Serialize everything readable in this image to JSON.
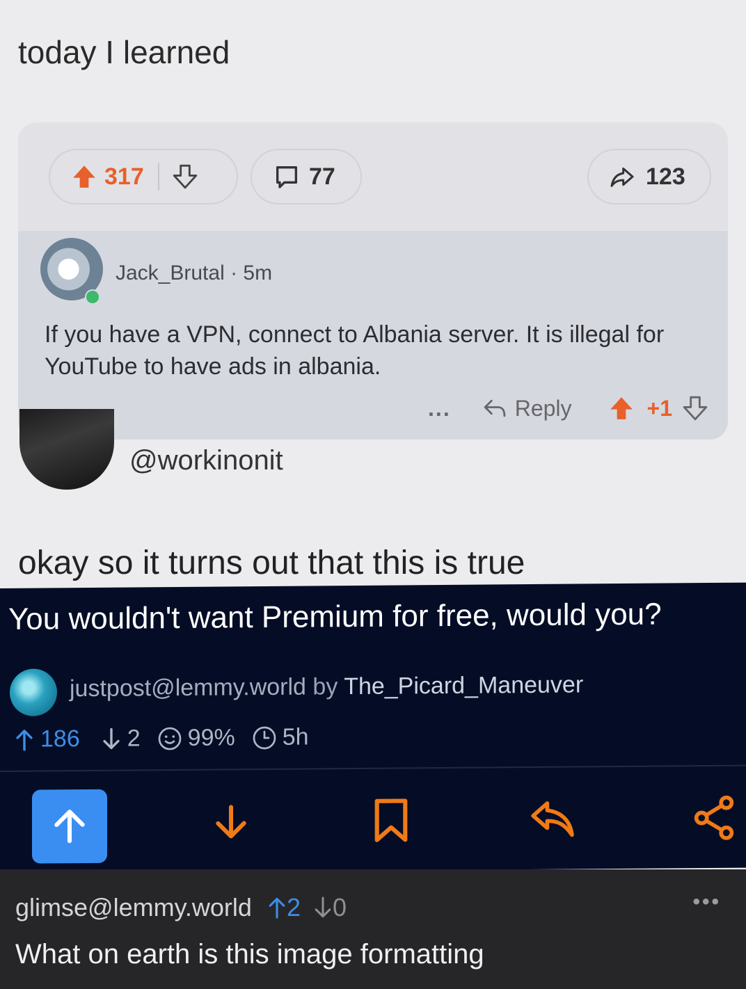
{
  "top": {
    "caption": "today I learned",
    "card": {
      "upvotes": "317",
      "comments": "77",
      "shares": "123",
      "comment": {
        "author": "Jack_Brutal",
        "time": "5m",
        "text": "If you have a VPN, connect to Albania server.  It is illegal for YouTube to have ads in albania.",
        "more": "...",
        "reply_label": "Reply",
        "score": "+1"
      }
    },
    "handle": "@workinonit",
    "caption2": "okay so it turns out that this is true"
  },
  "post": {
    "title": "You wouldn't want Premium for free, would you?",
    "community": "justpost@lemmy.world",
    "by": "by",
    "user": "The_Picard_Maneuver",
    "upvotes": "186",
    "downvotes": "2",
    "ratio": "99%",
    "age": "5h"
  },
  "reply": {
    "user": "glimse@lemmy.world",
    "upvotes": "2",
    "downvotes": "0",
    "more": "•••",
    "body": "What on earth is this image formatting"
  },
  "colors": {
    "reddit_orange": "#e8602a",
    "lemmy_bg": "#050d26",
    "lemmy_blue": "#3a8ef2",
    "action_orange": "#f07a16"
  }
}
